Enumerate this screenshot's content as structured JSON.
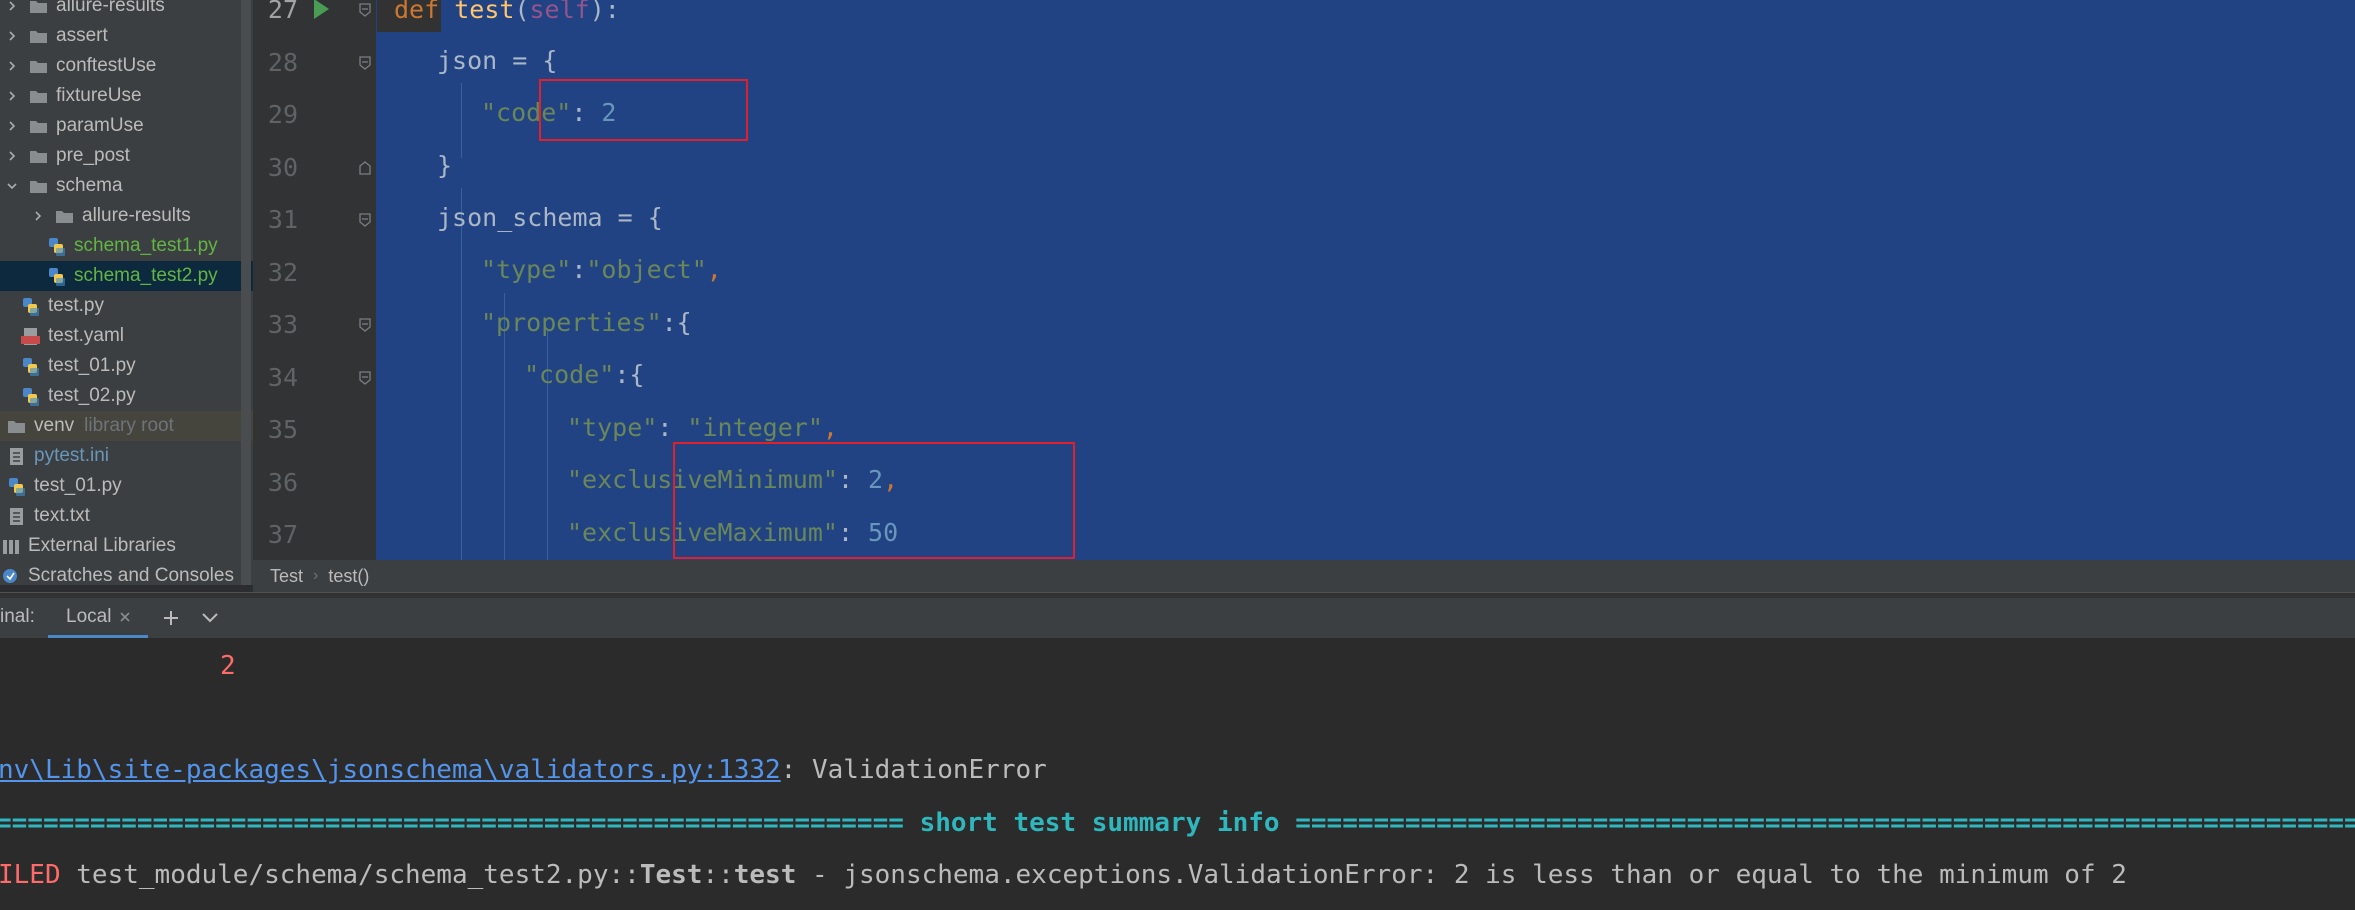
{
  "project_tree": {
    "items": [
      {
        "label": "allure-results",
        "type": "folder",
        "expanded": false
      },
      {
        "label": "assert",
        "type": "folder",
        "expanded": false
      },
      {
        "label": "conftestUse",
        "type": "folder",
        "expanded": false
      },
      {
        "label": "fixtureUse",
        "type": "folder",
        "expanded": false
      },
      {
        "label": "paramUse",
        "type": "folder",
        "expanded": false
      },
      {
        "label": "pre_post",
        "type": "folder",
        "expanded": false
      },
      {
        "label": "schema",
        "type": "folder",
        "expanded": true
      },
      {
        "label": "allure-results",
        "type": "folder",
        "expanded": false
      },
      {
        "label": "schema_test1.py",
        "type": "python"
      },
      {
        "label": "schema_test2.py",
        "type": "python",
        "selected": true
      },
      {
        "label": "test.py",
        "type": "python"
      },
      {
        "label": "test.yaml",
        "type": "yaml"
      },
      {
        "label": "test_01.py",
        "type": "python"
      },
      {
        "label": "test_02.py",
        "type": "python"
      },
      {
        "label": "venv",
        "note": "library root",
        "type": "folder"
      },
      {
        "label": "pytest.ini",
        "type": "ini"
      },
      {
        "label": "test_01.py",
        "type": "python"
      },
      {
        "label": "text.txt",
        "type": "text"
      },
      {
        "label": "External Libraries",
        "type": "library"
      },
      {
        "label": "Scratches and Consoles",
        "type": "scratch"
      }
    ]
  },
  "editor": {
    "line_numbers": [
      "27",
      "28",
      "29",
      "30",
      "31",
      "32",
      "33",
      "34",
      "35",
      "36",
      "37"
    ],
    "code": {
      "l27": {
        "kw": "def",
        "fn": "test",
        "open": "(",
        "self": "self",
        "close": "):"
      },
      "l28": {
        "text": "json = {"
      },
      "l29": {
        "key": "\"code\"",
        "sep": ": ",
        "val": "2"
      },
      "l30": {
        "text": "}"
      },
      "l31": {
        "text": "json_schema = {"
      },
      "l32": {
        "key": "\"type\"",
        "sep": ":",
        "val": "\"object\"",
        "comma": ","
      },
      "l33": {
        "key": "\"properties\"",
        "sep": ":{"
      },
      "l34": {
        "key": "\"code\"",
        "sep": ":{"
      },
      "l35": {
        "key": "\"type\"",
        "sep": ": ",
        "val": "\"integer\"",
        "comma": ","
      },
      "l36": {
        "key": "\"exclusiveMinimum\"",
        "sep": ": ",
        "val": "2",
        "comma": ","
      },
      "l37": {
        "key": "\"exclusiveMaximum\"",
        "sep": ": ",
        "val": "50"
      }
    }
  },
  "breadcrumb": {
    "class_name": "Test",
    "separator": "›",
    "method": "test()"
  },
  "terminal": {
    "title": "inal:",
    "tab_label": "Local",
    "lines": {
      "printed_value": "2",
      "error_path": "nv\\Lib\\site-packages\\jsonschema\\validators.py:1332",
      "error_suffix": ": ValidationError",
      "summary_left": "==========================================================",
      "summary_text": "short test summary info",
      "summary_right": "===========================================================================",
      "failed_prefix": "ILED",
      "failed_path": " test_module/schema/schema_test2.py::",
      "failed_class": "Test",
      "failed_sep": "::",
      "failed_test": "test",
      "failed_message": " - jsonschema.exceptions.ValidationError: 2 is less than or equal to the minimum of 2"
    }
  },
  "colors": {
    "editor_selection": "#214283",
    "highlight_box": "#e0202a",
    "terminal_bg": "#2b2b2b",
    "link": "#5394ec",
    "summary": "#2fb7be",
    "error": "#ff6b68"
  }
}
